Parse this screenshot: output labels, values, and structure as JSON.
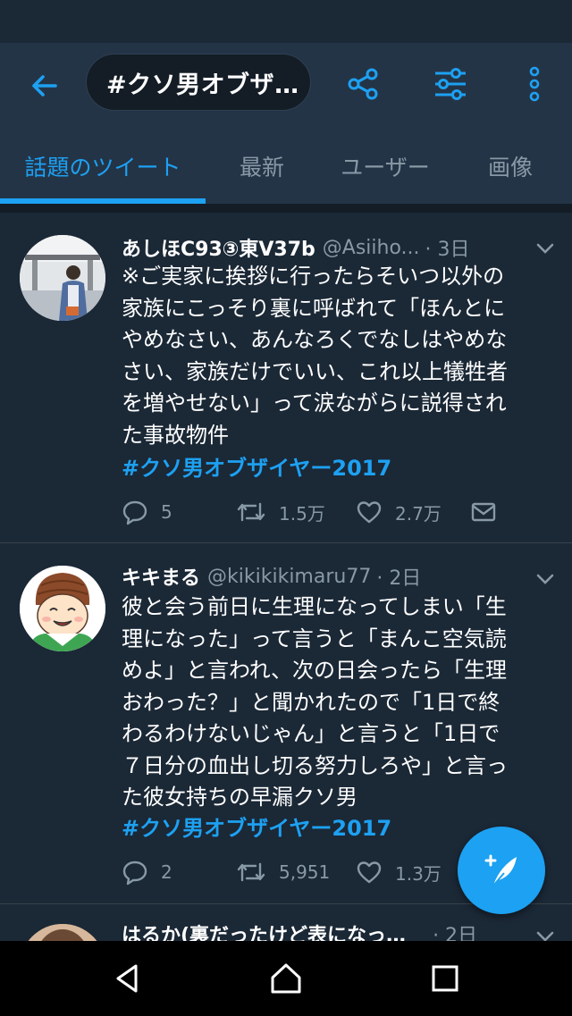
{
  "search": {
    "query": "#クソ男オブザ…"
  },
  "tabs": [
    {
      "label": "話題のツイート"
    },
    {
      "label": "最新"
    },
    {
      "label": "ユーザー"
    },
    {
      "label": "画像"
    }
  ],
  "tweets": [
    {
      "name": "あしほC93③東V37b",
      "handle": "@Asiiho...",
      "time": "· 3日",
      "text": "※ご実家に挨拶に行ったらそいつ以外の\n家族にこっそり裏に呼ばれて「ほんとに\nやめなさい、あんなろくでなしはやめな\nさい、家族だけでいい、これ以上犠牲者\nを増やせない」って涙ながらに説得され\nた事故物件",
      "hashtag": "#クソ男オブザイヤー2017",
      "replies": "5",
      "retweets": "1.5万",
      "likes": "2.7万"
    },
    {
      "name": "キキまる",
      "handle": "@kikikikimaru77",
      "time": "· 2日",
      "text": "彼と会う前日に生理になってしまい「生\n理になった」って言うと「まんこ空気読\nめよ」と言われ、次の日会ったら「生理\nおわった？」と聞かれたので「1日で終\nわるわけないじゃん」と言うと「1日で\n７日分の血出し切る努力しろや」と言っ\nた彼女持ちの早漏クソ男",
      "hashtag": "#クソ男オブザイヤー2017",
      "replies": "2",
      "retweets": "5,951",
      "likes": "1.3万"
    },
    {
      "name": "はるか(裏だったけど表になっ…",
      "time": "· 2日"
    }
  ],
  "colors": {
    "accent": "#1da1f2",
    "background": "#1b2836",
    "appbar": "#243447",
    "muted": "#8899a6"
  },
  "icons": [
    "back-arrow-icon",
    "share-icon",
    "filter-icon",
    "more-vert-icon",
    "chevron-down-icon",
    "reply-icon",
    "retweet-icon",
    "like-icon",
    "dm-icon",
    "compose-icon",
    "nav-back-icon",
    "nav-home-icon",
    "nav-recents-icon"
  ]
}
